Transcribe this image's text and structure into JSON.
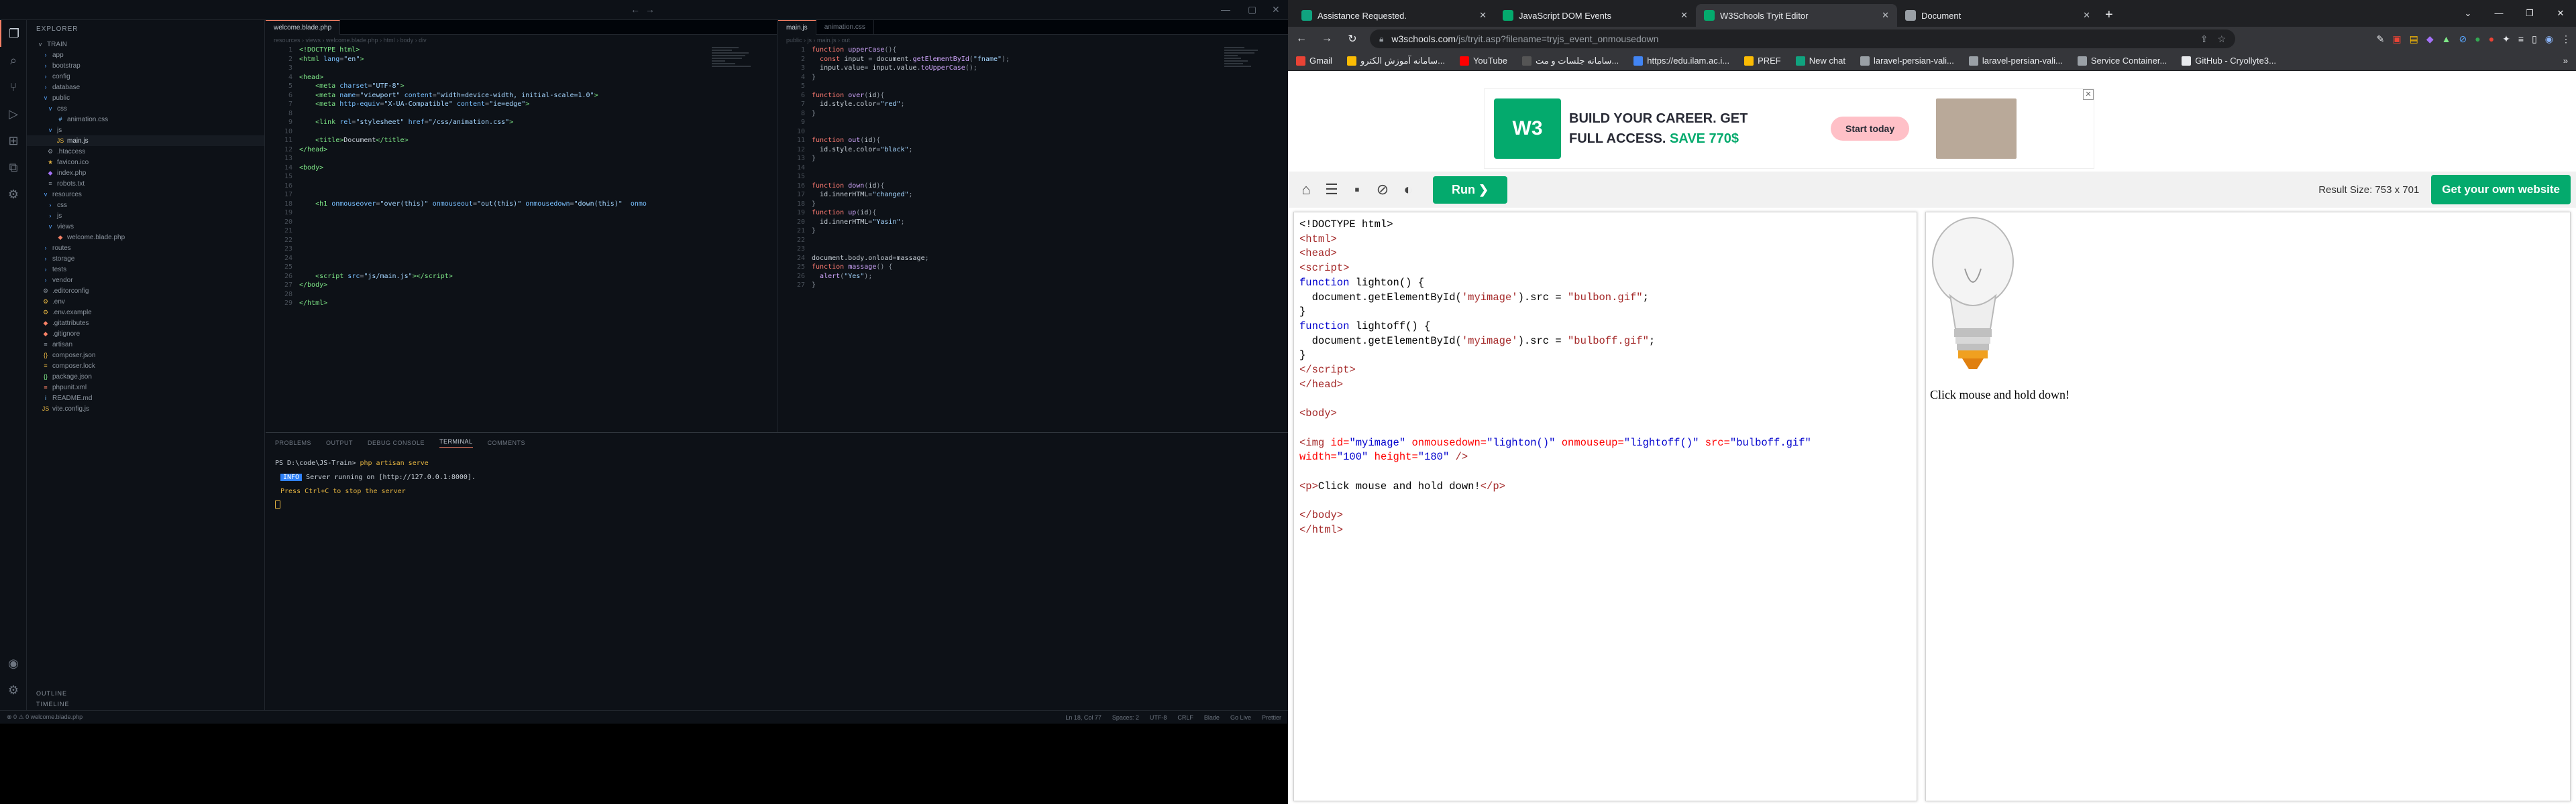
{
  "vscode": {
    "explorer_title": "EXPLORER",
    "tree": [
      {
        "label": "TRAIN",
        "icon": "v",
        "color": "#8b949e"
      },
      {
        "label": "app",
        "icon": "›",
        "color": "#58a6ff"
      },
      {
        "label": "bootstrap",
        "icon": "›",
        "color": "#58a6ff"
      },
      {
        "label": "config",
        "icon": "›",
        "color": "#58a6ff"
      },
      {
        "label": "database",
        "icon": "›",
        "color": "#58a6ff"
      },
      {
        "label": "public",
        "icon": "v",
        "color": "#58a6ff"
      },
      {
        "label": "css",
        "icon": "v",
        "color": "#58a6ff"
      },
      {
        "label": "animation.css",
        "icon": "#",
        "color": "#79c0ff"
      },
      {
        "label": "js",
        "icon": "v",
        "color": "#58a6ff"
      },
      {
        "label": "main.js",
        "icon": "JS",
        "color": "#e3b341"
      },
      {
        "label": ".htaccess",
        "icon": "⚙",
        "color": "#8b949e"
      },
      {
        "label": "favicon.ico",
        "icon": "★",
        "color": "#e3b341"
      },
      {
        "label": "index.php",
        "icon": "◆",
        "color": "#a371f7"
      },
      {
        "label": "robots.txt",
        "icon": "≡",
        "color": "#8b949e"
      },
      {
        "label": "resources",
        "icon": "v",
        "color": "#58a6ff"
      },
      {
        "label": "css",
        "icon": "›",
        "color": "#58a6ff"
      },
      {
        "label": "js",
        "icon": "›",
        "color": "#58a6ff"
      },
      {
        "label": "views",
        "icon": "v",
        "color": "#58a6ff"
      },
      {
        "label": "welcome.blade.php",
        "icon": "◆",
        "color": "#f78166"
      },
      {
        "label": "routes",
        "icon": "›",
        "color": "#58a6ff"
      },
      {
        "label": "storage",
        "icon": "›",
        "color": "#58a6ff"
      },
      {
        "label": "tests",
        "icon": "›",
        "color": "#58a6ff"
      },
      {
        "label": "vendor",
        "icon": "›",
        "color": "#58a6ff"
      },
      {
        "label": ".editorconfig",
        "icon": "⚙",
        "color": "#8b949e"
      },
      {
        "label": ".env",
        "icon": "⚙",
        "color": "#e3b341"
      },
      {
        "label": ".env.example",
        "icon": "⚙",
        "color": "#e3b341"
      },
      {
        "label": ".gitattributes",
        "icon": "◆",
        "color": "#f78166"
      },
      {
        "label": ".gitignore",
        "icon": "◆",
        "color": "#f78166"
      },
      {
        "label": "artisan",
        "icon": "≡",
        "color": "#8b949e"
      },
      {
        "label": "composer.json",
        "icon": "{}",
        "color": "#e3b341"
      },
      {
        "label": "composer.lock",
        "icon": "≡",
        "color": "#e3b341"
      },
      {
        "label": "package.json",
        "icon": "{}",
        "color": "#7ee787"
      },
      {
        "label": "phpunit.xml",
        "icon": "≡",
        "color": "#f78166"
      },
      {
        "label": "README.md",
        "icon": "i",
        "color": "#79c0ff"
      },
      {
        "label": "vite.config.js",
        "icon": "JS",
        "color": "#e3b341"
      }
    ],
    "outline_label": "OUTLINE",
    "timeline_label": "TIMELINE",
    "left_tabs": [
      "welcome.blade.php"
    ],
    "right_tabs": [
      "main.js",
      "animation.css"
    ],
    "left_crumbs": "resources › views › welcome.blade.php › html › body › div",
    "right_crumbs": "public › js › main.js › out",
    "left_code": [
      {
        "n": "1",
        "h": "<span class='tg'>&lt;!DOCTYPE html&gt;</span>"
      },
      {
        "n": "2",
        "h": "<span class='tg'>&lt;html</span> <span class='at'>lang</span>=<span class='st'>\"en\"</span><span class='tg'>&gt;</span>"
      },
      {
        "n": "3",
        "h": ""
      },
      {
        "n": "4",
        "h": "<span class='tg'>&lt;head&gt;</span>"
      },
      {
        "n": "5",
        "h": "    <span class='tg'>&lt;meta</span> <span class='at'>charset</span>=<span class='st'>\"UTF-8\"</span><span class='tg'>&gt;</span>"
      },
      {
        "n": "6",
        "h": "    <span class='tg'>&lt;meta</span> <span class='at'>name</span>=<span class='st'>\"viewport\"</span> <span class='at'>content</span>=<span class='st'>\"width=device-width, initial-scale=1.0\"</span><span class='tg'>&gt;</span>"
      },
      {
        "n": "7",
        "h": "    <span class='tg'>&lt;meta</span> <span class='at'>http-equiv</span>=<span class='st'>\"X-UA-Compatible\"</span> <span class='at'>content</span>=<span class='st'>\"ie=edge\"</span><span class='tg'>&gt;</span>"
      },
      {
        "n": "8",
        "h": ""
      },
      {
        "n": "9",
        "h": "    <span class='tg'>&lt;link</span> <span class='at'>rel</span>=<span class='st'>\"stylesheet\"</span> <span class='at'>href</span>=<span class='st'>\"/css/animation.css\"</span><span class='tg'>&gt;</span>"
      },
      {
        "n": "10",
        "h": ""
      },
      {
        "n": "11",
        "h": "    <span class='tg'>&lt;title&gt;</span><span class='tx'>Document</span><span class='tg'>&lt;/title&gt;</span>"
      },
      {
        "n": "12",
        "h": "<span class='tg'>&lt;/head&gt;</span>"
      },
      {
        "n": "13",
        "h": ""
      },
      {
        "n": "14",
        "h": "<span class='tg'>&lt;body&gt;</span>"
      },
      {
        "n": "15",
        "h": ""
      },
      {
        "n": "16",
        "h": ""
      },
      {
        "n": "17",
        "h": ""
      },
      {
        "n": "18",
        "h": "    <span class='tg'>&lt;h1</span> <span class='at'>onmouseover</span>=<span class='st'>\"over(this)\"</span> <span class='at'>onmouseout</span>=<span class='st'>\"out(this)\"</span> <span class='at'>onmousedown</span>=<span class='st'>\"down(this)\"</span>  <span class='at'>onmo</span>"
      },
      {
        "n": "19",
        "h": ""
      },
      {
        "n": "20",
        "h": ""
      },
      {
        "n": "21",
        "h": ""
      },
      {
        "n": "22",
        "h": ""
      },
      {
        "n": "23",
        "h": ""
      },
      {
        "n": "24",
        "h": ""
      },
      {
        "n": "25",
        "h": ""
      },
      {
        "n": "26",
        "h": "    <span class='tg'>&lt;script</span> <span class='at'>src</span>=<span class='st'>\"js/main.js\"</span><span class='tg'>&gt;&lt;/script&gt;</span>"
      },
      {
        "n": "27",
        "h": "<span class='tg'>&lt;/body&gt;</span>"
      },
      {
        "n": "28",
        "h": ""
      },
      {
        "n": "29",
        "h": "<span class='tg'>&lt;/html&gt;</span>"
      }
    ],
    "right_code": [
      {
        "n": "1",
        "h": "<span class='kw'>function</span> <span class='fn'>upperCase</span>(){"
      },
      {
        "n": "2",
        "h": "  <span class='kw'>const</span> <span class='tx'>input</span> = <span class='tx'>document</span>.<span class='fn'>getElementById</span>(<span class='st'>\"fname\"</span>);"
      },
      {
        "n": "3",
        "h": "  <span class='tx'>input.value</span>= <span class='tx'>input.value</span>.<span class='fn'>toUpperCase</span>();"
      },
      {
        "n": "4",
        "h": "}"
      },
      {
        "n": "5",
        "h": ""
      },
      {
        "n": "6",
        "h": "<span class='kw'>function</span> <span class='fn'>over</span>(<span class='tx'>id</span>){"
      },
      {
        "n": "7",
        "h": "  <span class='tx'>id.style.color</span>=<span class='st'>\"red\"</span>;"
      },
      {
        "n": "8",
        "h": "}"
      },
      {
        "n": "9",
        "h": ""
      },
      {
        "n": "10",
        "h": ""
      },
      {
        "n": "11",
        "h": "<span class='kw'>function</span> <span class='fn'>out</span>(<span class='tx'>id</span>){"
      },
      {
        "n": "12",
        "h": "  <span class='tx'>id.style.color</span>=<span class='st'>\"black\"</span>;"
      },
      {
        "n": "13",
        "h": "}"
      },
      {
        "n": "14",
        "h": ""
      },
      {
        "n": "15",
        "h": ""
      },
      {
        "n": "16",
        "h": "<span class='kw'>function</span> <span class='fn'>down</span>(<span class='tx'>id</span>){"
      },
      {
        "n": "17",
        "h": "  <span class='tx'>id.innerHTML</span>=<span class='st'>\"changed\"</span>;"
      },
      {
        "n": "18",
        "h": "}"
      },
      {
        "n": "19",
        "h": "<span class='kw'>function</span> <span class='fn'>up</span>(<span class='tx'>id</span>){"
      },
      {
        "n": "20",
        "h": "  <span class='tx'>id.innerHTML</span>=<span class='st'>\"Yasin\"</span>;"
      },
      {
        "n": "21",
        "h": "}"
      },
      {
        "n": "22",
        "h": ""
      },
      {
        "n": "23",
        "h": ""
      },
      {
        "n": "24",
        "h": "<span class='tx'>document.body.onload</span>=<span class='tx'>massage</span>;"
      },
      {
        "n": "25",
        "h": "<span class='kw'>function</span> <span class='fn'>massage</span>() {"
      },
      {
        "n": "26",
        "h": "  <span class='fn'>alert</span>(<span class='st'>\"Yes\"</span>);"
      },
      {
        "n": "27",
        "h": "}"
      }
    ],
    "panel_tabs": [
      "PROBLEMS",
      "OUTPUT",
      "DEBUG CONSOLE",
      "TERMINAL",
      "COMMENTS"
    ],
    "panel_active": "TERMINAL",
    "terminal": {
      "prompt": "PS D:\\code\\JS-Train> ",
      "command": "php artisan serve",
      "info_tag": "INFO",
      "server_msg": "Server running on [http://127.0.0.1:8000].",
      "stop_msg": "Press Ctrl+C to stop the server"
    },
    "status": {
      "left": "⊗ 0  ⚠ 0    welcome.blade.php",
      "right": [
        "Ln 18, Col 77",
        "Spaces: 2",
        "UTF-8",
        "CRLF",
        "Blade",
        "Go Live",
        "Prettier"
      ]
    }
  },
  "chrome": {
    "tabs": [
      {
        "label": "Assistance Requested.",
        "fav_color": "#10a37f",
        "active": false
      },
      {
        "label": "JavaScript DOM Events",
        "fav_color": "#04aa6d",
        "active": false
      },
      {
        "label": "W3Schools Tryit Editor",
        "fav_color": "#04aa6d",
        "active": true
      },
      {
        "label": "Document",
        "fav_color": "#9aa0a6",
        "active": false
      }
    ],
    "url_host": "w3schools.com",
    "url_path": "/js/tryit.asp?filename=tryjs_event_onmousedown",
    "bookmarks": [
      {
        "label": "Gmail",
        "color": "#ea4335"
      },
      {
        "label": "سامانه آموزش الکترو...",
        "color": "#fbbc04"
      },
      {
        "label": "YouTube",
        "color": "#ff0000"
      },
      {
        "label": "سامانه جلسات و مت...",
        "color": "#555555"
      },
      {
        "label": "https://edu.ilam.ac.i...",
        "color": "#4285f4"
      },
      {
        "label": "PREF",
        "color": "#fbbc04"
      },
      {
        "label": "New chat",
        "color": "#10a37f"
      },
      {
        "label": "laravel-persian-vali...",
        "color": "#9aa0a6"
      },
      {
        "label": "laravel-persian-vali...",
        "color": "#9aa0a6"
      },
      {
        "label": "Service Container...",
        "color": "#9aa0a6"
      },
      {
        "label": "GitHub - Cryollyte3...",
        "color": "#e8eaed"
      }
    ],
    "ad": {
      "logo": "W3",
      "logo_sub": "schools",
      "line1": "BUILD YOUR CAREER. GET",
      "line2": "FULL ACCESS. ",
      "save": "SAVE 770$",
      "cta": "Start today"
    },
    "run_label": "Run ❯",
    "result_size": "Result Size: 753 x 701",
    "get_website": "Get your own website",
    "result_text": "Click mouse and hold down!"
  }
}
